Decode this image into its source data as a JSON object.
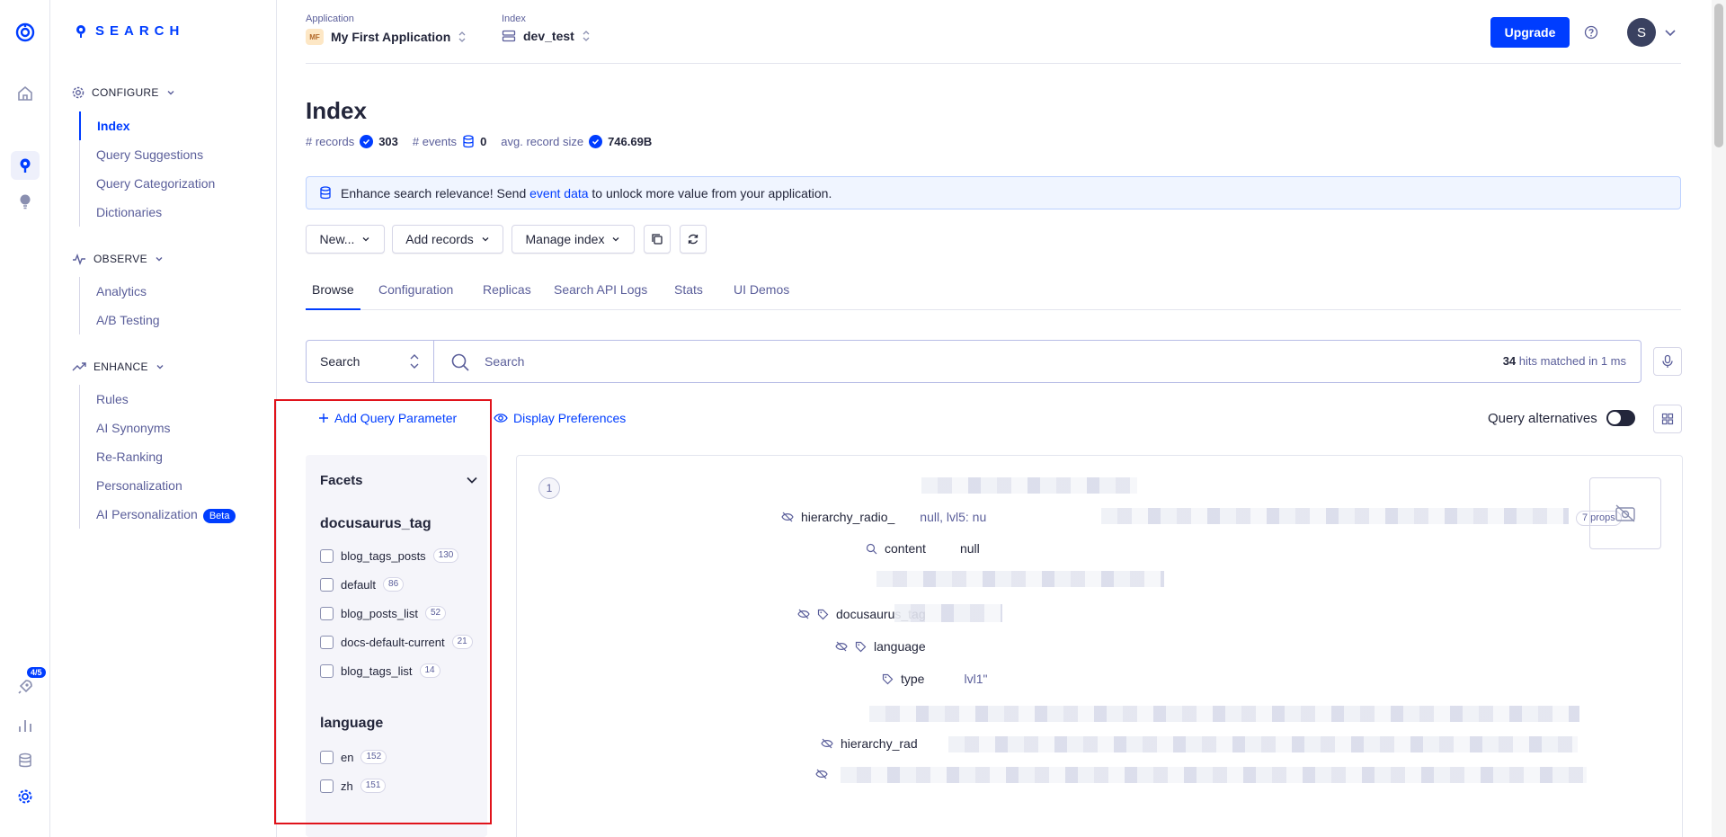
{
  "brand": {
    "name": "SEARCH"
  },
  "rail": {
    "badge": "4/5"
  },
  "sidebar": {
    "configure": {
      "label": "CONFIGURE",
      "items": [
        "Index",
        "Query Suggestions",
        "Query Categorization",
        "Dictionaries"
      ]
    },
    "observe": {
      "label": "OBSERVE",
      "items": [
        "Analytics",
        "A/B Testing"
      ]
    },
    "enhance": {
      "label": "ENHANCE",
      "items": [
        "Rules",
        "AI Synonyms",
        "Re-Ranking",
        "Personalization",
        "AI Personalization"
      ],
      "beta_label": "Beta"
    }
  },
  "topbar": {
    "application_label": "Application",
    "application_initials": "MF",
    "application_name": "My First Application",
    "index_label": "Index",
    "index_name": "dev_test",
    "upgrade_label": "Upgrade",
    "avatar_initial": "S"
  },
  "page": {
    "title": "Index",
    "records_label": "# records",
    "records_value": "303",
    "events_label": "# events",
    "events_value": "0",
    "size_label": "avg. record size",
    "size_value": "746.69B"
  },
  "banner": {
    "text_before": "Enhance search relevance! Send ",
    "link": "event data",
    "text_after": " to unlock more value from your application."
  },
  "toolbar": {
    "new_label": "New...",
    "add_records_label": "Add records",
    "manage_label": "Manage index"
  },
  "tabs": [
    "Browse",
    "Configuration",
    "Replicas",
    "Search API Logs",
    "Stats",
    "UI Demos"
  ],
  "search": {
    "type": "Search",
    "placeholder": "Search",
    "hits_count": "34",
    "hits_text": " hits matched in 1 ms"
  },
  "links": {
    "add_param": "Add Query Parameter",
    "display_prefs": "Display Preferences"
  },
  "query_alternatives": {
    "label": "Query alternatives",
    "enabled": false
  },
  "facets": {
    "title": "Facets",
    "groups": [
      {
        "name": "docusaurus_tag",
        "items": [
          {
            "label": "blog_tags_posts",
            "count": "130"
          },
          {
            "label": "default",
            "count": "86"
          },
          {
            "label": "blog_posts_list",
            "count": "52"
          },
          {
            "label": "docs-default-current",
            "count": "21"
          },
          {
            "label": "blog_tags_list",
            "count": "14"
          }
        ]
      },
      {
        "name": "language",
        "items": [
          {
            "label": "en",
            "count": "152"
          },
          {
            "label": "zh",
            "count": "151"
          }
        ]
      }
    ]
  },
  "record": {
    "number": "1",
    "attributes": {
      "a1": {
        "key": "hierarchy_radio_",
        "value": "null, lvl5: nu",
        "props": "7 props"
      },
      "a2": {
        "key": "content",
        "value": "null"
      },
      "a3": {
        "key": "docusaurus_tag",
        "value": ""
      },
      "a4": {
        "key": "language",
        "value": ""
      },
      "a5": {
        "key": "type",
        "value": "lvl1\""
      },
      "a6": {
        "key": "hierarchy_rad",
        "value": ""
      }
    }
  },
  "colors": {
    "accent": "#003dff",
    "highlight": "#e0131b",
    "text": "#23263b",
    "muted": "#5a5e9a"
  }
}
